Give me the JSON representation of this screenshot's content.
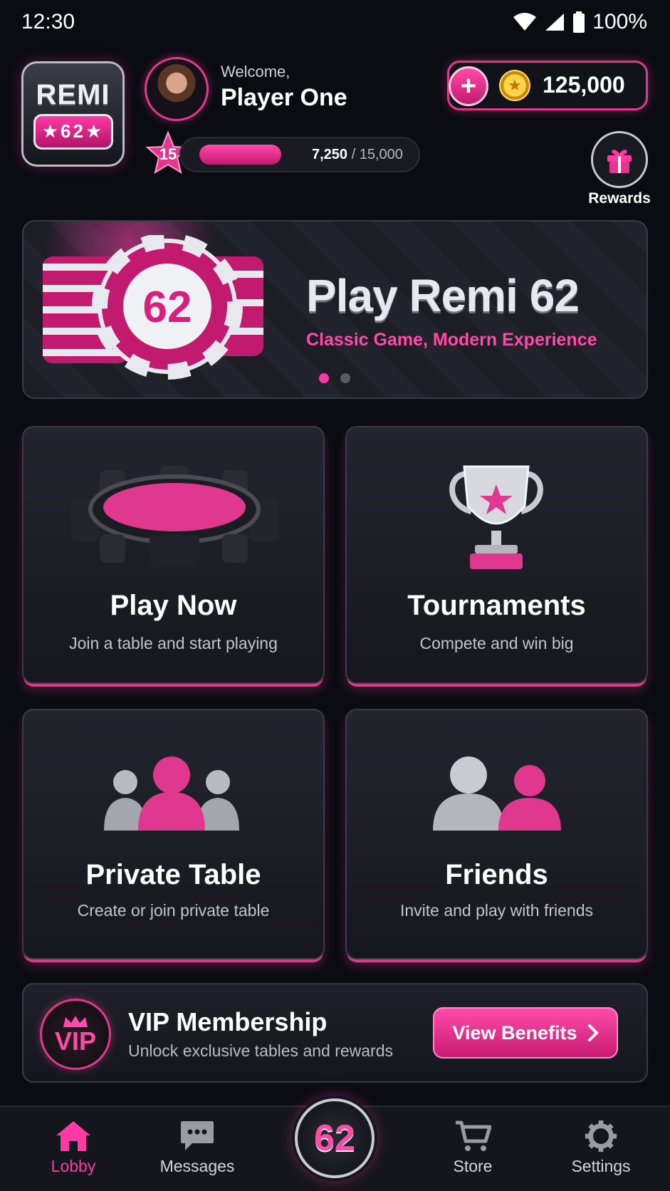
{
  "status_bar": {
    "time": "12:30",
    "battery": "100%"
  },
  "header": {
    "logo_title": "REMI",
    "logo_number": "★62★",
    "welcome": "Welcome,",
    "player_name": "Player One",
    "level": "15",
    "xp_current": "7,250",
    "xp_max": "/ 15,000",
    "xp_progress": 0.48,
    "coins": "125,000",
    "rewards_label": "Rewards"
  },
  "banner": {
    "chip_number": "62",
    "title": "Play Remi 62",
    "subtitle": "Classic Game, Modern Experience",
    "slide_count": 2,
    "active_slide": 1
  },
  "cards": [
    {
      "title": "Play Now",
      "subtitle": "Join a table and start playing",
      "icon": "poker-table-icon"
    },
    {
      "title": "Tournaments",
      "subtitle": "Compete and win big",
      "icon": "trophy-icon"
    },
    {
      "title": "Private Table",
      "subtitle": "Create or join private table",
      "icon": "group-icon"
    },
    {
      "title": "Friends",
      "subtitle": "Invite and play with friends",
      "icon": "friends-icon"
    }
  ],
  "vip": {
    "badge": "VIP",
    "title": "VIP Membership",
    "subtitle": "Unlock exclusive tables and rewards",
    "button": "View Benefits"
  },
  "bottom_nav": {
    "items": [
      {
        "label": "Lobby",
        "icon": "home-icon",
        "active": true
      },
      {
        "label": "Messages",
        "icon": "chat-icon",
        "active": false
      },
      {
        "label": "Store",
        "icon": "cart-icon",
        "active": false
      },
      {
        "label": "Settings",
        "icon": "gear-icon",
        "active": false
      }
    ],
    "center_label": "62"
  },
  "colors": {
    "accent": "#ff3aa6",
    "background": "#0b0c12",
    "card": "#1d1f27"
  }
}
